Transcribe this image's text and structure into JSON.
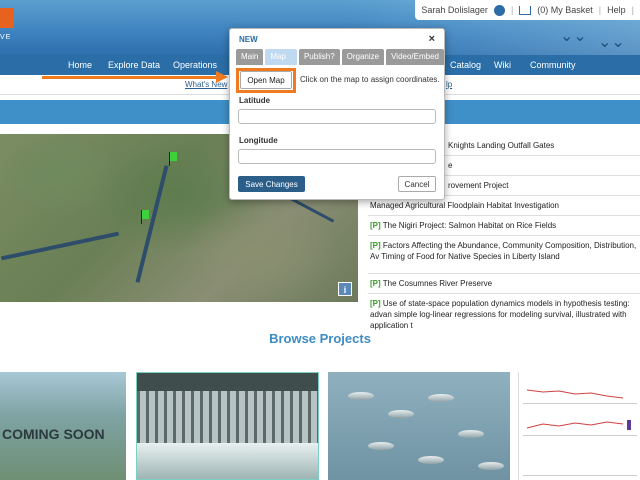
{
  "header": {
    "logo_text": "VE",
    "user_name": "Sarah Dolislager",
    "basket": "(0) My Basket",
    "help": "Help"
  },
  "nav": {
    "items": [
      "Home",
      "Explore Data",
      "Operations",
      "Catalog",
      "Wiki",
      "Community"
    ]
  },
  "subnav": {
    "whats_new": "What's New",
    "help": "lp"
  },
  "dialog": {
    "title": "NEW",
    "close": "×",
    "tabs": [
      "Main",
      "Map It!",
      "Publish?",
      "Organize",
      "Video/Embed"
    ],
    "active_tab": "Map It!",
    "open_map": "Open Map",
    "hint": "Click on the map to assign coordinates.",
    "latitude_label": "Latitude",
    "latitude_value": "",
    "longitude_label": "Longitude",
    "longitude_value": "",
    "save": "Save Changes",
    "cancel": "Cancel"
  },
  "map": {
    "info": "i"
  },
  "projects": [
    {
      "tag": "",
      "text": "Knights Landing Outfall Gates"
    },
    {
      "tag": "",
      "text": "e"
    },
    {
      "tag": "",
      "text": "rovement Project"
    },
    {
      "tag": "",
      "text": "Managed Agricultural Floodplain Habitat Investigation"
    },
    {
      "tag": "[P]",
      "text": " The Nigiri Project: Salmon Habitat on Rice Fields"
    },
    {
      "tag": "[P]",
      "text": " Factors Affecting the Abundance, Community Composition, Distribution, Av Timing of Food for Native Species in Liberty Island"
    },
    {
      "tag": "[P]",
      "text": " The Cosumnes River Preserve"
    },
    {
      "tag": "[P]",
      "text": " Use of state-space population dynamics models in hypothesis testing: advan simple log-linear regressions for modeling survival, illustrated with application t"
    }
  ],
  "browse": {
    "title": "Browse Projects",
    "coming_soon": "COMING SOON"
  },
  "colors": {
    "accent_orange": "#f07a1f",
    "nav_blue": "#2b6ea7",
    "project_tag_green": "#3a9a2a"
  }
}
